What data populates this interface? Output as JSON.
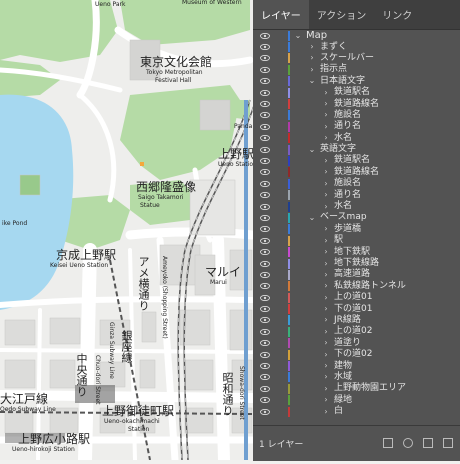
{
  "map": {
    "labels": [
      {
        "id": "ueno-park",
        "text": "Ueno Park",
        "cls": "en"
      },
      {
        "id": "tokyo-bunka-jp",
        "text": "東京文化会館",
        "cls": "jp"
      },
      {
        "id": "tokyo-bunka-en1",
        "text": "Tokyo Metropolitan",
        "cls": "en"
      },
      {
        "id": "tokyo-bunka-en2",
        "text": "Festival Hall",
        "cls": "en"
      },
      {
        "id": "ueno-eki-jp",
        "text": "上野駅",
        "cls": "jp"
      },
      {
        "id": "ueno-eki-en",
        "text": "Ueno Station",
        "cls": "en"
      },
      {
        "id": "saigo-jp",
        "text": "西郷隆盛像",
        "cls": "jp"
      },
      {
        "id": "saigo-en1",
        "text": "Saigo Takamori",
        "cls": "en"
      },
      {
        "id": "saigo-en2",
        "text": "Statue",
        "cls": "en"
      },
      {
        "id": "pond-en",
        "text": "ike Pond",
        "cls": "en"
      },
      {
        "id": "keisei-jp",
        "text": "京成上野駅",
        "cls": "jp"
      },
      {
        "id": "keisei-en",
        "text": "Keisei Ueno Station",
        "cls": "en"
      },
      {
        "id": "marui-jp",
        "text": "マルイ",
        "cls": "jp"
      },
      {
        "id": "marui-en",
        "text": "Marui",
        "cls": "en"
      },
      {
        "id": "ginza-jp",
        "text": "銀座線",
        "cls": "jp"
      },
      {
        "id": "ginza-en",
        "text": "Ginza Subway Line",
        "cls": "en"
      },
      {
        "id": "ooedo-jp",
        "text": "大江戸線",
        "cls": "jp"
      },
      {
        "id": "ooedo-en",
        "text": "Oedo Subway Line",
        "cls": "en"
      },
      {
        "id": "okachimachi-jp",
        "text": "上野御徒町駅",
        "cls": "jp"
      },
      {
        "id": "okachimachi-en1",
        "text": "Ueno-okachimachi",
        "cls": "en"
      },
      {
        "id": "okachimachi-en2",
        "text": "Station",
        "cls": "en"
      },
      {
        "id": "hirokoji-jp",
        "text": "上野広小路駅",
        "cls": "jp"
      },
      {
        "id": "hirokoji-en",
        "text": "Ueno-hirokoji Station",
        "cls": "en"
      },
      {
        "id": "panda",
        "text": "Panda",
        "cls": "en"
      },
      {
        "id": "ameyoko-jp",
        "text": "アメ横通り",
        "cls": "jp"
      },
      {
        "id": "ameyoko-en",
        "text": "Ameyoko (Shopping Street)",
        "cls": "en"
      },
      {
        "id": "chuo-jp",
        "text": "中央通り",
        "cls": "jp"
      },
      {
        "id": "chuo-en",
        "text": "Chuo-dori Street",
        "cls": "en"
      },
      {
        "id": "showa-jp",
        "text": "昭和通り",
        "cls": "jp"
      },
      {
        "id": "showa-en",
        "text": "Showa-dori Street",
        "cls": "en"
      },
      {
        "id": "museum-en",
        "text": "Museum of Western",
        "cls": "en"
      }
    ]
  },
  "panel": {
    "tabs": [
      "レイヤー",
      "アクション",
      "リンク"
    ],
    "layers": [
      {
        "name": "Map",
        "depth": 0,
        "color": "#3b7bd8",
        "expanded": true
      },
      {
        "name": "まずく",
        "depth": 1,
        "color": "#3b7bd8",
        "expanded": false
      },
      {
        "name": "スケールバー",
        "depth": 1,
        "color": "#d7a24b",
        "expanded": false
      },
      {
        "name": "指示点",
        "depth": 1,
        "color": "#5aa13c",
        "expanded": false
      },
      {
        "name": "日本語文字",
        "depth": 1,
        "color": "#6a6ad8",
        "expanded": true
      },
      {
        "name": "鉄道駅名",
        "depth": 2,
        "color": "#8f8fe6",
        "expanded": false
      },
      {
        "name": "鉄道路線名",
        "depth": 2,
        "color": "#d23e3e",
        "expanded": false
      },
      {
        "name": "施設名",
        "depth": 2,
        "color": "#3b7bd8",
        "expanded": false
      },
      {
        "name": "通り名",
        "depth": 2,
        "color": "#b03aa8",
        "expanded": false
      },
      {
        "name": "水名",
        "depth": 2,
        "color": "#c42a2a",
        "expanded": false
      },
      {
        "name": "英語文字",
        "depth": 1,
        "color": "#7a5cc4",
        "expanded": true
      },
      {
        "name": "鉄道駅名",
        "depth": 2,
        "color": "#2e3fbf",
        "expanded": false
      },
      {
        "name": "鉄道路線名",
        "depth": 2,
        "color": "#8f2a2a",
        "expanded": false
      },
      {
        "name": "施設名",
        "depth": 2,
        "color": "#3b5fd8",
        "expanded": false
      },
      {
        "name": "通り名",
        "depth": 2,
        "color": "#9aa3ad",
        "expanded": false
      },
      {
        "name": "水名",
        "depth": 2,
        "color": "#1f3f8f",
        "expanded": false
      },
      {
        "name": "ベースmap",
        "depth": 1,
        "color": "#2aa6b0",
        "expanded": true
      },
      {
        "name": "歩道橋",
        "depth": 2,
        "color": "#3b7bd8",
        "expanded": false
      },
      {
        "name": "駅",
        "depth": 2,
        "color": "#d7a24b",
        "expanded": false
      },
      {
        "name": "地下鉄駅",
        "depth": 2,
        "color": "#c84ad0",
        "expanded": false
      },
      {
        "name": "地下鉄線路",
        "depth": 2,
        "color": "#8f8fe6",
        "expanded": false
      },
      {
        "name": "高速道路",
        "depth": 2,
        "color": "#a8a8c8",
        "expanded": false
      },
      {
        "name": "私鉄線路トンネル",
        "depth": 2,
        "color": "#d27a3a",
        "expanded": false
      },
      {
        "name": "上の道01",
        "depth": 2,
        "color": "#d25a5a",
        "expanded": false
      },
      {
        "name": "下の道01",
        "depth": 2,
        "color": "#d23e3e",
        "expanded": false
      },
      {
        "name": "JR線路",
        "depth": 2,
        "color": "#3b9bd8",
        "expanded": false
      },
      {
        "name": "上の道02",
        "depth": 2,
        "color": "#3ab07a",
        "expanded": false
      },
      {
        "name": "道塗り",
        "depth": 2,
        "color": "#b04ab0",
        "expanded": false
      },
      {
        "name": "下の道02",
        "depth": 2,
        "color": "#d2a03a",
        "expanded": false
      },
      {
        "name": "建物",
        "depth": 2,
        "color": "#8f5ad8",
        "expanded": false
      },
      {
        "name": "水域",
        "depth": 2,
        "color": "#3b7bd8",
        "expanded": false
      },
      {
        "name": "上野動物園エリア",
        "depth": 2,
        "color": "#9a9a3a",
        "expanded": false
      },
      {
        "name": "緑地",
        "depth": 2,
        "color": "#5aa13c",
        "expanded": false
      },
      {
        "name": "白",
        "depth": 2,
        "color": "#c43a3a",
        "expanded": false
      }
    ],
    "footer_count": "1 レイヤー"
  },
  "colors": {
    "park_green": "#b5dba6",
    "water_blue": "#a6d8f0",
    "panel_bg": "#535353",
    "panel_tabs_bg": "#3f3f3f"
  }
}
